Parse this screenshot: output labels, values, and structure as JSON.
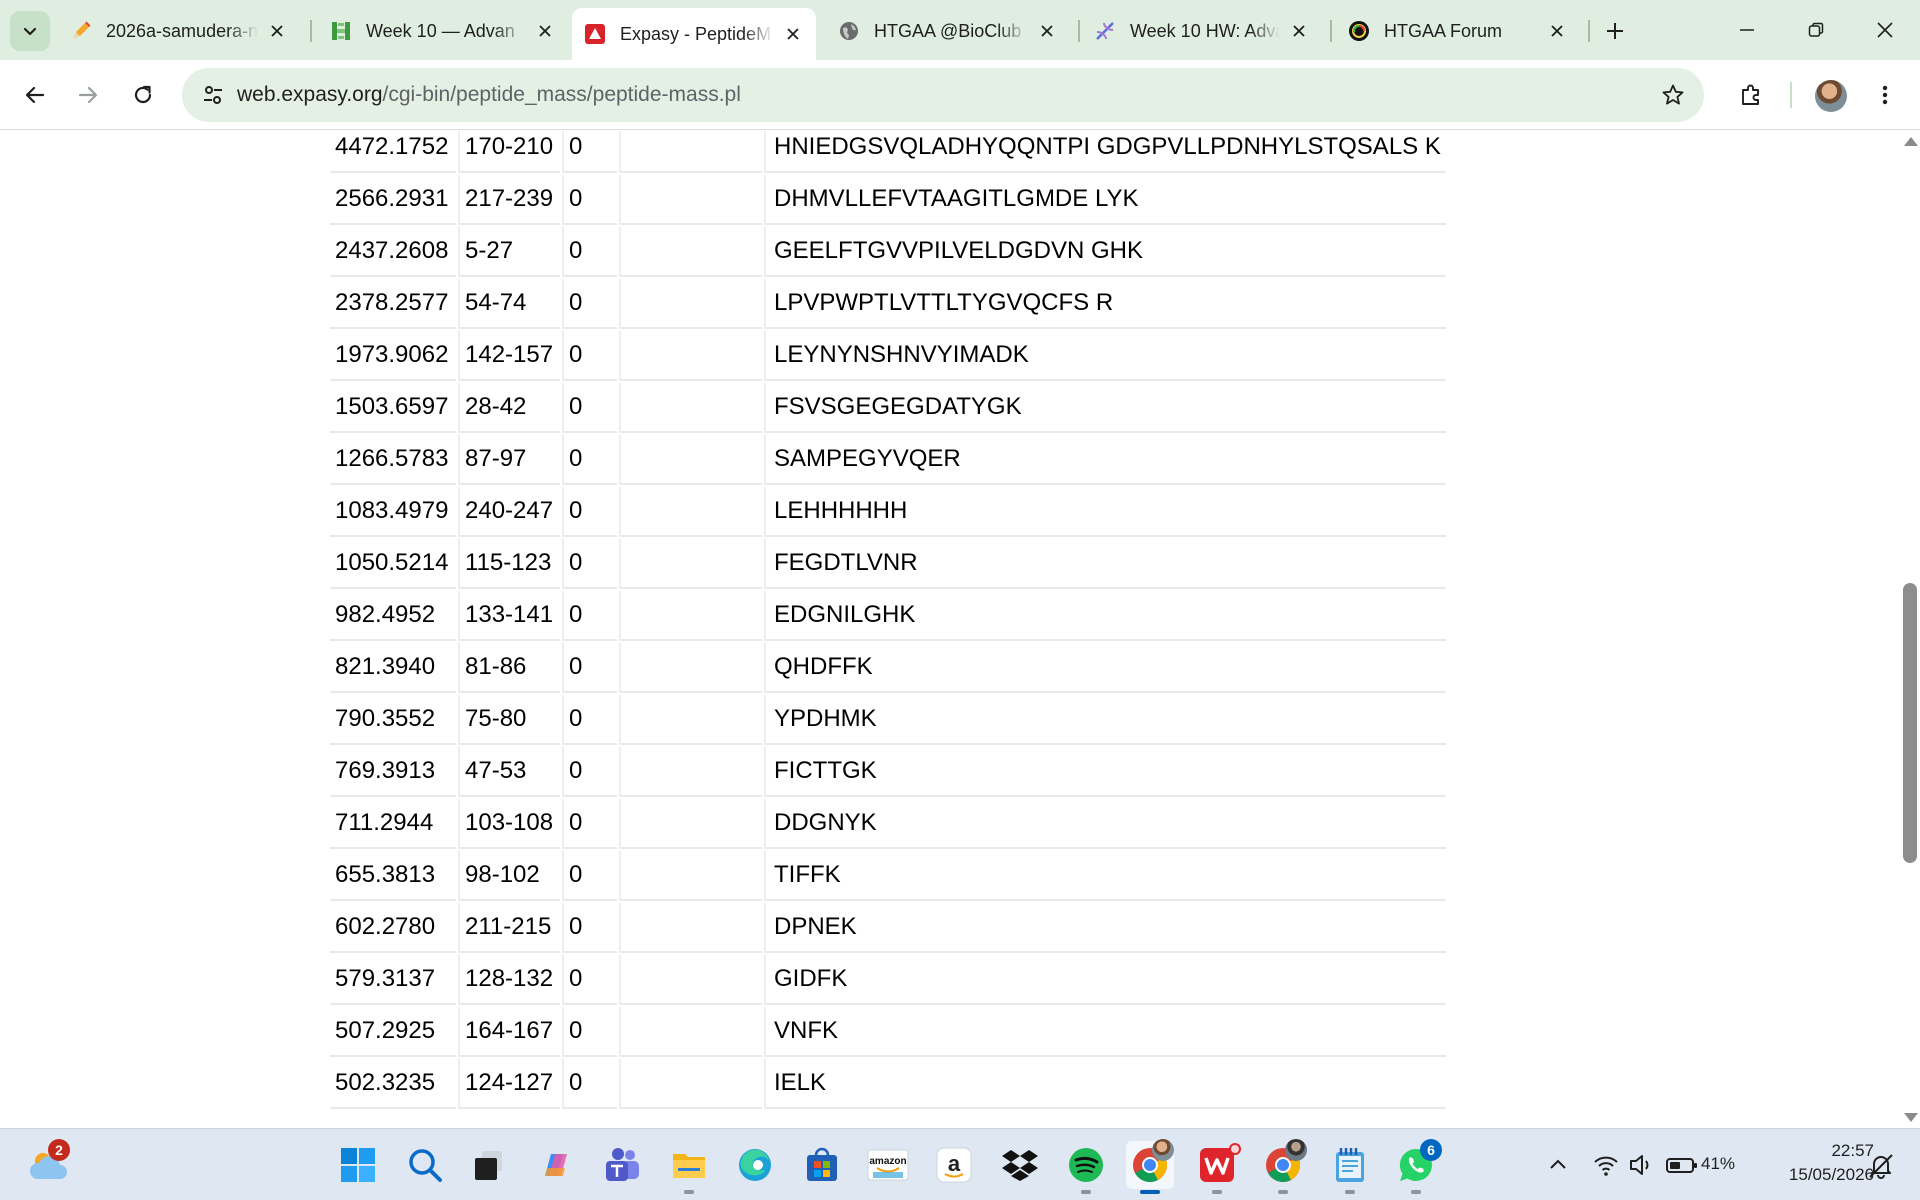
{
  "browser": {
    "tabs": [
      {
        "title": "2026a-samudera-n",
        "icon": "pencil-icon",
        "active": false
      },
      {
        "title": "Week 10 — Advan",
        "icon": "htgaa-logo-icon",
        "active": false
      },
      {
        "title": "Expasy - PeptideM",
        "icon": "expasy-logo-icon",
        "active": true
      },
      {
        "title": "HTGAA @BioClub",
        "icon": "globe-icon",
        "active": false
      },
      {
        "title": "Week 10 HW: Adva",
        "icon": "dna-icon",
        "active": false
      },
      {
        "title": "HTGAA Forum",
        "icon": "discourse-logo-icon",
        "active": false
      }
    ],
    "address": {
      "host": "web.expasy.org",
      "path": "/cgi-bin/peptide_mass/peptide-mass.pl"
    }
  },
  "peptides": [
    {
      "mass": "4472.1752",
      "position": "170-210",
      "missed": "0",
      "modifications": "",
      "sequence": "HNIEDGSVQLADHYQQNTPI GDGPVLLPDNHYLSTQSALS K"
    },
    {
      "mass": "2566.2931",
      "position": "217-239",
      "missed": "0",
      "modifications": "",
      "sequence": "DHMVLLEFVTAAGITLGMDE LYK"
    },
    {
      "mass": "2437.2608",
      "position": "5-27",
      "missed": "0",
      "modifications": "",
      "sequence": "GEELFTGVVPILVELDGDVN GHK"
    },
    {
      "mass": "2378.2577",
      "position": "54-74",
      "missed": "0",
      "modifications": "",
      "sequence": "LPVPWPTLVTTLTYGVQCFS R"
    },
    {
      "mass": "1973.9062",
      "position": "142-157",
      "missed": "0",
      "modifications": "",
      "sequence": "LEYNYNSHNVYIMADK"
    },
    {
      "mass": "1503.6597",
      "position": "28-42",
      "missed": "0",
      "modifications": "",
      "sequence": "FSVSGEGEGDATYGK"
    },
    {
      "mass": "1266.5783",
      "position": "87-97",
      "missed": "0",
      "modifications": "",
      "sequence": "SAMPEGYVQER"
    },
    {
      "mass": "1083.4979",
      "position": "240-247",
      "missed": "0",
      "modifications": "",
      "sequence": "LEHHHHHH"
    },
    {
      "mass": "1050.5214",
      "position": "115-123",
      "missed": "0",
      "modifications": "",
      "sequence": "FEGDTLVNR"
    },
    {
      "mass": "982.4952",
      "position": "133-141",
      "missed": "0",
      "modifications": "",
      "sequence": "EDGNILGHK"
    },
    {
      "mass": "821.3940",
      "position": "81-86",
      "missed": "0",
      "modifications": "",
      "sequence": "QHDFFK"
    },
    {
      "mass": "790.3552",
      "position": "75-80",
      "missed": "0",
      "modifications": "",
      "sequence": "YPDHMK"
    },
    {
      "mass": "769.3913",
      "position": "47-53",
      "missed": "0",
      "modifications": "",
      "sequence": "FICTTGK"
    },
    {
      "mass": "711.2944",
      "position": "103-108",
      "missed": "0",
      "modifications": "",
      "sequence": "DDGNYK"
    },
    {
      "mass": "655.3813",
      "position": "98-102",
      "missed": "0",
      "modifications": "",
      "sequence": "TIFFK"
    },
    {
      "mass": "602.2780",
      "position": "211-215",
      "missed": "0",
      "modifications": "",
      "sequence": "DPNEK"
    },
    {
      "mass": "579.3137",
      "position": "128-132",
      "missed": "0",
      "modifications": "",
      "sequence": "GIDFK"
    },
    {
      "mass": "507.2925",
      "position": "164-167",
      "missed": "0",
      "modifications": "",
      "sequence": "VNFK"
    },
    {
      "mass": "502.3235",
      "position": "124-127",
      "missed": "0",
      "modifications": "",
      "sequence": "IELK"
    }
  ],
  "taskbar": {
    "weather_badge": "2",
    "whatsapp_badge": "6",
    "battery": "41%",
    "time": "22:57",
    "date": "15/05/2026"
  },
  "colors": {
    "tabstrip_bg": "#dfeee0",
    "omnibox_bg": "#e3f0e3",
    "taskbar_bg": "#dfe8f2",
    "row_border": "#e9e9e9",
    "badge_red": "#c42b1c",
    "badge_blue": "#0067c0"
  }
}
